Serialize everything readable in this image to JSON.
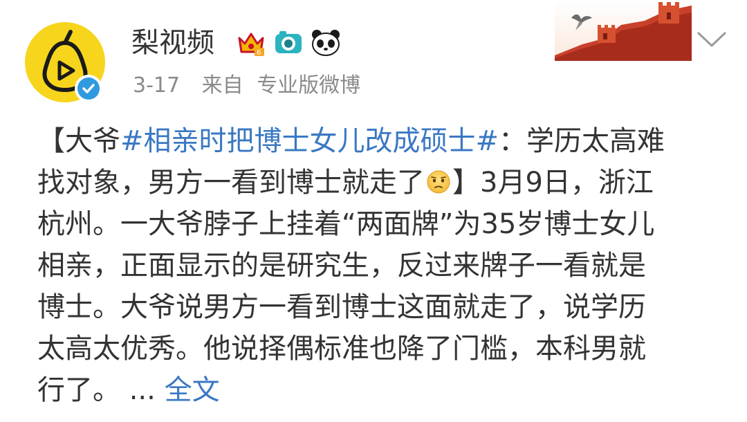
{
  "author": {
    "name": "梨视频",
    "verified": true,
    "badges": [
      "crown-badge-icon",
      "camera-badge-icon",
      "panda-badge-icon"
    ]
  },
  "meta": {
    "date": "3-17",
    "source_prefix": "来自",
    "source": "专业版微博"
  },
  "post": {
    "l1_a": "【大爷",
    "l1_topic": "#相亲时把博士女儿改成硕士#",
    "l1_b": "：学历太高难",
    "l2_a": "找对象，男方一看到博士就走了",
    "l2_b": "】3月9日，浙江",
    "l3": "杭州。一大爷脖子上挂着“两面牌”为35岁博士女儿",
    "l4": "相亲，正面显示的是研究生，反过来牌子一看就是",
    "l5": "博士。大爷说男方一看到博士这面就走了，说学历",
    "l6": "太高太优秀。他说择偶标准也降了门槛，本科男就",
    "l7_a": "行了。 ... ",
    "full_text_link": "全文"
  },
  "colors": {
    "topic": "#3a78c3",
    "text": "#333333",
    "meta": "#8a8a8a",
    "avatar_bg": "#f7d51c",
    "verified": "#2f9ae0"
  }
}
